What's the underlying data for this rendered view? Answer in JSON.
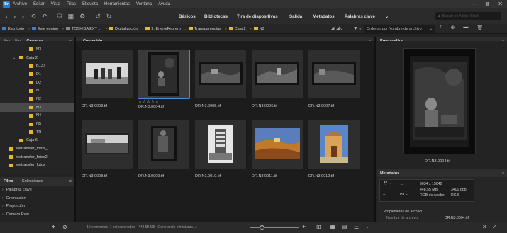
{
  "menubar": {
    "logo_text": "Br",
    "items": [
      "Archivo",
      "Editar",
      "Vista",
      "Pilas",
      "Etiqueta",
      "Herramientas",
      "Ventana",
      "Ayuda"
    ]
  },
  "window_controls": [
    "—",
    "⧉",
    "✕"
  ],
  "toolbar": {
    "workspaces": [
      "Básicos",
      "Bibliotecas",
      "Tira de diapositivas",
      "Salida",
      "Metadatos",
      "Palabras clave"
    ],
    "search_placeholder": "Buscar en Adobe Stock",
    "workspaces_more": "⌄"
  },
  "pathbar": {
    "crumbs": [
      "Escritorio",
      "Este equipo",
      "TOSHIBA EXT ...",
      "Digitalización",
      "II. Enero/Febrero",
      "Transparencias",
      "Caja 2",
      "N3"
    ],
    "sort_label": "Ordenar por Nombre de archivo"
  },
  "left_panel": {
    "tabs": [
      "Fav",
      "Fav",
      "Carpetas"
    ],
    "tree": [
      {
        "label": "N3",
        "indent": 2,
        "arrow": "",
        "selected": false
      },
      {
        "label": "Caja 2",
        "indent": 1,
        "arrow": "⌄",
        "selected": false
      },
      {
        "label": "B137",
        "indent": 2,
        "arrow": "",
        "selected": false
      },
      {
        "label": "D1",
        "indent": 2,
        "arrow": "",
        "selected": false
      },
      {
        "label": "D2",
        "indent": 2,
        "arrow": "",
        "selected": false
      },
      {
        "label": "N1",
        "indent": 2,
        "arrow": "",
        "selected": false
      },
      {
        "label": "N2",
        "indent": 2,
        "arrow": "",
        "selected": false
      },
      {
        "label": "N3",
        "indent": 2,
        "arrow": "",
        "selected": true
      },
      {
        "label": "N4",
        "indent": 2,
        "arrow": "",
        "selected": false
      },
      {
        "label": "N5",
        "indent": 2,
        "arrow": "",
        "selected": false
      },
      {
        "label": "TR",
        "indent": 2,
        "arrow": "",
        "selected": false
      },
      {
        "label": "Caja 6",
        "indent": 1,
        "arrow": "›",
        "selected": false
      },
      {
        "label": "wetransfer_fotos_",
        "indent": 0,
        "arrow": "",
        "selected": false
      },
      {
        "label": "wetransfer_fotos2",
        "indent": 0,
        "arrow": "",
        "selected": false
      },
      {
        "label": "wetransfer_fotos",
        "indent": 0,
        "arrow": "",
        "selected": false
      }
    ],
    "filter_title": "Filtro",
    "collections_tab": "Colecciones",
    "filters": [
      "Palabras clave",
      "Orientación",
      "Proporción",
      "Camera Raw"
    ]
  },
  "content": {
    "tab": "Contenido",
    "items": [
      {
        "name": "DR.N3.0003.tif",
        "kind": "group",
        "selected": false,
        "stars": ""
      },
      {
        "name": "DR.N3.0004.tif",
        "kind": "dark-portrait",
        "selected": true,
        "stars": "☆☆☆☆☆"
      },
      {
        "name": "DR.N3.0005.tif",
        "kind": "dark-land",
        "selected": false,
        "stars": ""
      },
      {
        "name": "DR.N3.0006.tif",
        "kind": "dark-land2",
        "selected": false,
        "stars": ""
      },
      {
        "name": "DR.N3.0007.tif",
        "kind": "dark-land3",
        "selected": false,
        "stars": ""
      },
      {
        "name": "DR.N3.0008.tif",
        "kind": "bw-land",
        "selected": false,
        "stars": ""
      },
      {
        "name": "DR.N3.0009.tif",
        "kind": "dark-portrait2",
        "selected": false,
        "stars": ""
      },
      {
        "name": "DR.N3.0010.tif",
        "kind": "building",
        "selected": false,
        "stars": ""
      },
      {
        "name": "DR.N3.0011.tif",
        "kind": "color-land",
        "selected": false,
        "stars": ""
      },
      {
        "name": "DR.N3.0012.tif",
        "kind": "color-port",
        "selected": false,
        "stars": ""
      }
    ]
  },
  "preview": {
    "title": "Previsualizar",
    "caption": "DR.N3.0004.tif"
  },
  "metadata": {
    "title": "Metadatos",
    "aperture": "ƒ/ --",
    "dash1": "--",
    "dash2": "--",
    "iso": "ISO--",
    "dimensions": "9034 x 15042",
    "size": "448.55 MB",
    "ppi": "3400 ppp",
    "profile": "RGB de Adobe",
    "mode": "RGB",
    "file_props": "Propiedades de archivo",
    "file_name_label": "Nombre de archivo",
    "file_name_value": "DR.N3.0004.tif"
  },
  "status": {
    "text": "10 elementos, 1 seleccionados - 448.55 MB (Generando miniaturas...)"
  }
}
